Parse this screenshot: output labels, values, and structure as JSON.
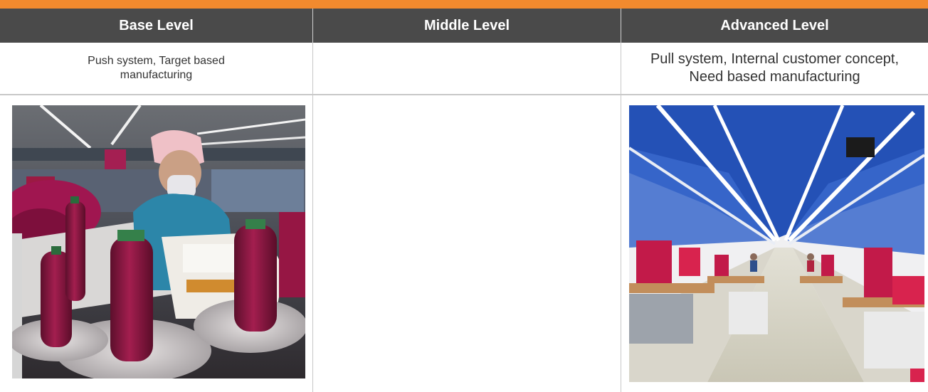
{
  "table": {
    "headers": [
      "Base Level",
      "Middle Level",
      "Advanced Level"
    ],
    "descriptions": {
      "base": [
        "Push system, Target based",
        "manufacturing"
      ],
      "middle": "",
      "advanced": [
        "Pull system, Internal customer concept,",
        "Need based manufacturing"
      ]
    },
    "images": {
      "base": "sewing-worker-photo",
      "advanced": "factory-production-line-photo"
    }
  },
  "colors": {
    "accent_bar": "#f28a2e",
    "header_bg": "#4a4a4a",
    "header_text": "#ffffff",
    "body_text": "#333333"
  }
}
